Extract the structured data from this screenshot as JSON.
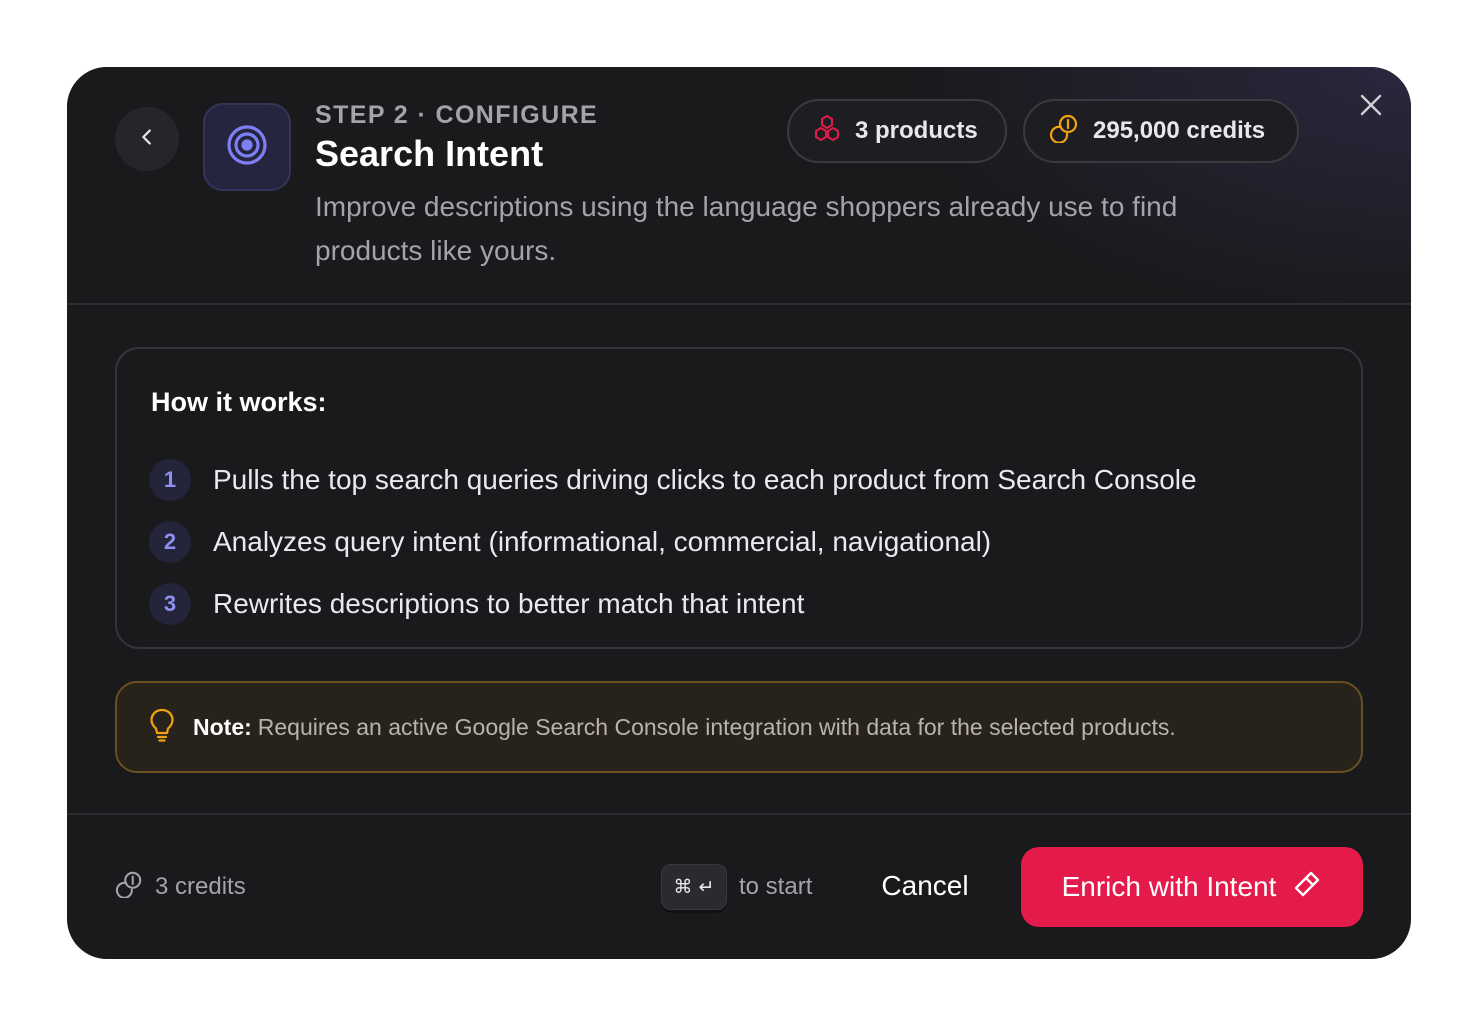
{
  "header": {
    "step_label": "STEP 2 · CONFIGURE",
    "title": "Search Intent",
    "description": "Improve descriptions using the language shoppers already use to find products like yours.",
    "icons": {
      "back": "chevron-left-icon",
      "feature": "target-icon",
      "close": "close-icon"
    },
    "products_pill": {
      "label": "3 products",
      "icon": "cubes-icon",
      "color": "#e41a4b"
    },
    "credits_pill": {
      "label": "295,000 credits",
      "icon": "coins-icon",
      "color": "#f2a30f"
    }
  },
  "how_it_works": {
    "title": "How it works:",
    "steps": [
      {
        "number": "1",
        "text": "Pulls the top search queries driving clicks to each product from Search Console"
      },
      {
        "number": "2",
        "text": "Analyzes query intent (informational, commercial, navigational)"
      },
      {
        "number": "3",
        "text": "Rewrites descriptions to better match that intent"
      }
    ]
  },
  "note": {
    "icon": "lightbulb-icon",
    "label": "Note:",
    "text": "Requires an active Google Search Console integration with data for the selected products."
  },
  "footer": {
    "cost_icon": "coins-icon",
    "cost_label": "3 credits",
    "shortcut_keys": "⌘ ↵",
    "shortcut_hint": "to start",
    "cancel_label": "Cancel",
    "primary_label": "Enrich with Intent",
    "primary_icon": "magic-wand-icon"
  },
  "colors": {
    "background": "#1a1a1d",
    "accent": "#e41a4b",
    "step_number": "#8f8ff2",
    "note_border": "#6a4f22",
    "note_icon": "#f2a30f"
  }
}
